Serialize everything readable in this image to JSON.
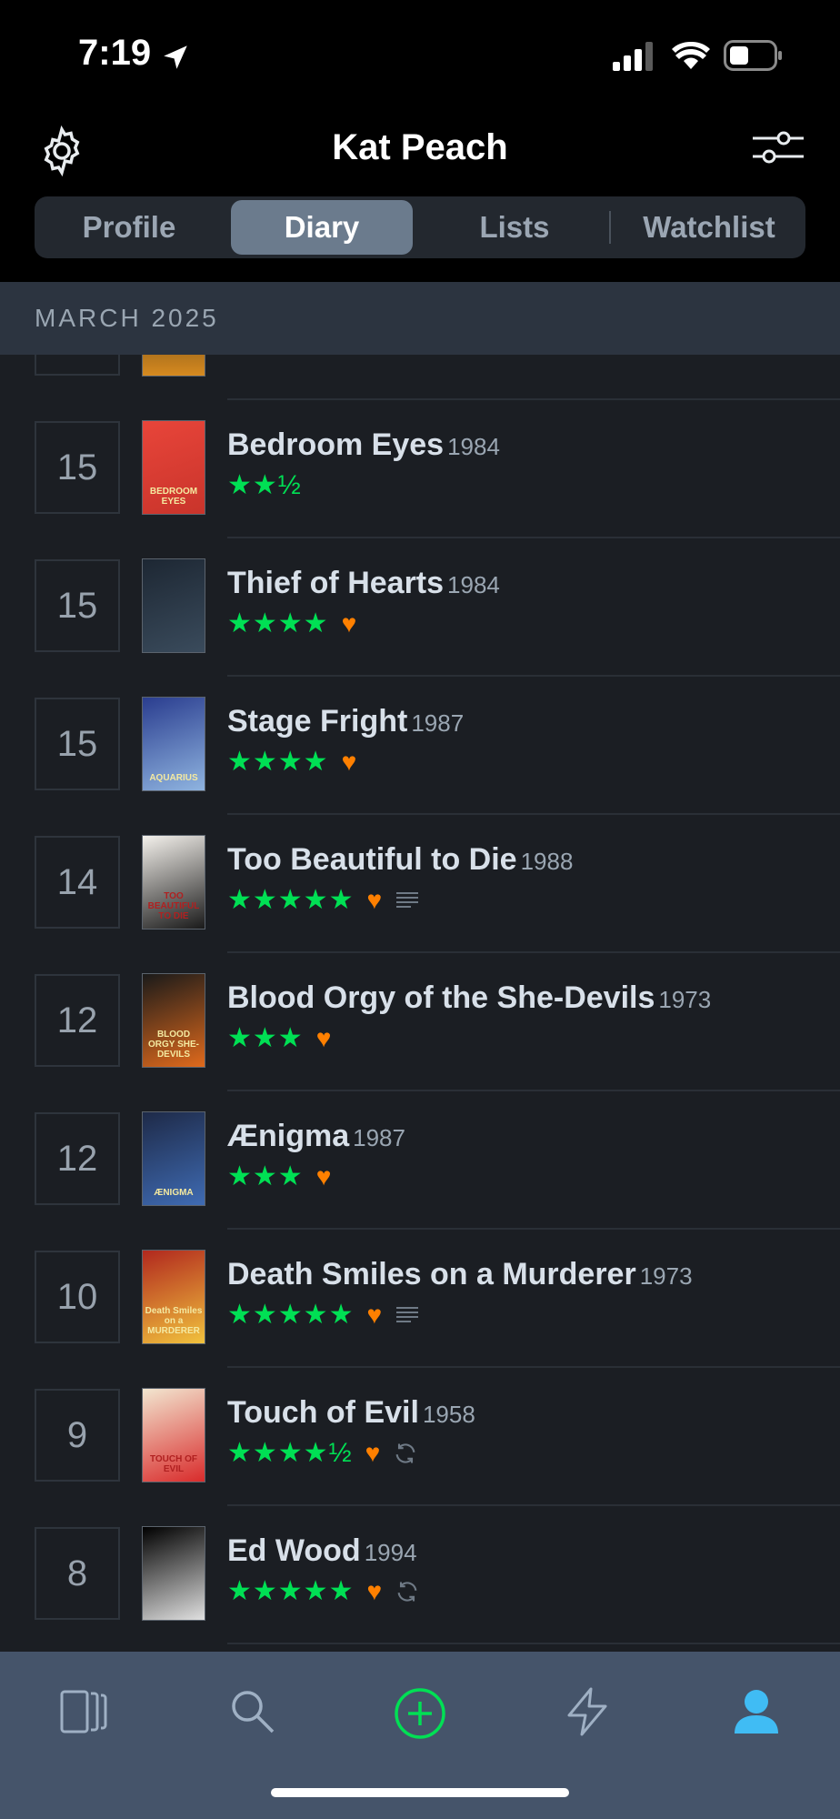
{
  "status": {
    "time": "7:19",
    "location_icon": "location-arrow-icon",
    "signal_icon": "signal-icon",
    "wifi_icon": "wifi-icon",
    "battery_icon": "battery-icon"
  },
  "header": {
    "title": "Kat Peach",
    "settings_icon": "gear-icon",
    "filter_icon": "sliders-icon"
  },
  "tabs": [
    {
      "label": "Profile",
      "active": false
    },
    {
      "label": "Diary",
      "active": true
    },
    {
      "label": "Lists",
      "active": false
    },
    {
      "label": "Watchlist",
      "active": false
    }
  ],
  "month": "MARCH 2025",
  "entries": [
    {
      "day": "15",
      "title": "Bedroom Eyes",
      "year": "1984",
      "stars": "★★½",
      "liked": false,
      "review": false,
      "rewatch": false,
      "poster_text": "BEDROOM EYES",
      "poster_colors": [
        "#e8453a",
        "#c9342b"
      ]
    },
    {
      "day": "15",
      "title": "Thief of Hearts",
      "year": "1984",
      "stars": "★★★★",
      "liked": true,
      "review": false,
      "rewatch": false,
      "poster_text": "",
      "poster_colors": [
        "#1d2733",
        "#3a4b5c"
      ]
    },
    {
      "day": "15",
      "title": "Stage Fright",
      "year": "1987",
      "stars": "★★★★",
      "liked": true,
      "review": false,
      "rewatch": false,
      "poster_text": "AQUARIUS",
      "poster_colors": [
        "#2a3d8f",
        "#8fb4e0"
      ]
    },
    {
      "day": "14",
      "title": "Too Beautiful to Die",
      "year": "1988",
      "stars": "★★★★★",
      "liked": true,
      "review": true,
      "rewatch": false,
      "poster_text": "TOO BEAUTIFUL TO DIE",
      "poster_colors": [
        "#f4f1ec",
        "#1a1a1a"
      ]
    },
    {
      "day": "12",
      "title": "Blood Orgy of the She-Devils",
      "year": "1973",
      "stars": "★★★",
      "liked": true,
      "review": false,
      "rewatch": false,
      "poster_text": "BLOOD ORGY SHE-DEVILS",
      "poster_colors": [
        "#1a1a1a",
        "#e06a1c"
      ]
    },
    {
      "day": "12",
      "title": "Ænigma",
      "year": "1987",
      "stars": "★★★",
      "liked": true,
      "review": false,
      "rewatch": false,
      "poster_text": "ÆNIGMA",
      "poster_colors": [
        "#1e2a48",
        "#3f6bb3"
      ]
    },
    {
      "day": "10",
      "title": "Death Smiles on a Murderer",
      "year": "1973",
      "stars": "★★★★★",
      "liked": true,
      "review": true,
      "rewatch": false,
      "poster_text": "Death Smiles on a MURDERER",
      "poster_colors": [
        "#b1281e",
        "#f1c23d"
      ]
    },
    {
      "day": "9",
      "title": "Touch of Evil",
      "year": "1958",
      "stars": "★★★★½",
      "liked": true,
      "review": false,
      "rewatch": true,
      "poster_text": "TOUCH OF EVIL",
      "poster_colors": [
        "#f2e6d0",
        "#d92b2b"
      ]
    },
    {
      "day": "8",
      "title": "Ed Wood",
      "year": "1994",
      "stars": "★★★★★",
      "liked": true,
      "review": false,
      "rewatch": true,
      "poster_text": "",
      "poster_colors": [
        "#000000",
        "#e0e0e0"
      ]
    }
  ],
  "tabbar": [
    {
      "name": "films-icon",
      "active": false
    },
    {
      "name": "search-icon",
      "active": false
    },
    {
      "name": "add-icon",
      "active": false
    },
    {
      "name": "activity-icon",
      "active": false
    },
    {
      "name": "profile-icon",
      "active": true
    }
  ],
  "colors": {
    "star": "#00e054",
    "heart": "#ff8000",
    "accent_active": "#40bcf4",
    "add": "#00e054"
  }
}
